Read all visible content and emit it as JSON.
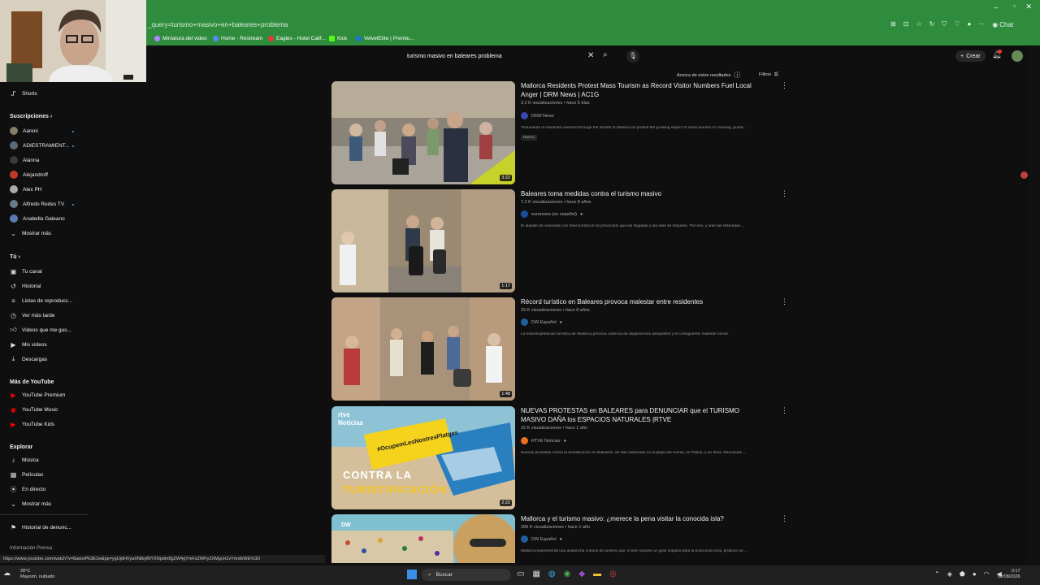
{
  "browser": {
    "address": "_query=turismo+masivo+en+baleares+problema",
    "chat_label": "Chat",
    "bookmarks": [
      {
        "label": "Miniatura del video",
        "color": "#b388ff"
      },
      {
        "label": "Home - Restream",
        "color": "#4f8cff"
      },
      {
        "label": "Eagles - Hotel Calif...",
        "color": "#e53935"
      },
      {
        "label": "Kick",
        "color": "#53fc18"
      },
      {
        "label": "VelvetElite | Premiu...",
        "color": "#1976d2"
      }
    ]
  },
  "youtube": {
    "search_query": "turismo masivo en baleares problema",
    "create_label": "Crear",
    "about_results": "Acerca de estos resultados",
    "filters_label": "Filtros"
  },
  "sidebar": {
    "shorts": "Shorts",
    "subscriptions_header": "Suscripciones",
    "subscriptions": [
      {
        "label": "Aareni",
        "color": "#8a7a6a",
        "new": true
      },
      {
        "label": "ADIESTRAMIENT...",
        "color": "#5a6a7a",
        "new": true
      },
      {
        "label": "Alanna",
        "color": "#3a3a3a",
        "new": false
      },
      {
        "label": "Alejandroff",
        "color": "#c0392b",
        "new": false
      },
      {
        "label": "Alex PH",
        "color": "#aaaaaa",
        "new": false
      },
      {
        "label": "Alfredo Redes TV",
        "color": "#6a7a8a",
        "new": true
      },
      {
        "label": "Anabella Galeano",
        "color": "#5d7bb0",
        "new": false
      }
    ],
    "show_more": "Mostrar más",
    "you_header": "Tú",
    "you_items": [
      {
        "label": "Tu canal",
        "icon": "channel-icon"
      },
      {
        "label": "Historial",
        "icon": "history-icon"
      },
      {
        "label": "Listas de reproducc...",
        "icon": "playlists-icon"
      },
      {
        "label": "Ver más tarde",
        "icon": "watch-later-icon"
      },
      {
        "label": "Videos que me gus...",
        "icon": "like-icon"
      },
      {
        "label": "Mis videos",
        "icon": "my-videos-icon"
      },
      {
        "label": "Descargas",
        "icon": "downloads-icon"
      }
    ],
    "more_header": "Más de YouTube",
    "more_items": [
      "YouTube Premium",
      "YouTube Music",
      "YouTube Kids"
    ],
    "explore_header": "Explorar",
    "explore_items": [
      {
        "label": "Música",
        "icon": "music-icon"
      },
      {
        "label": "Películas",
        "icon": "movies-icon"
      },
      {
        "label": "En directo",
        "icon": "live-icon"
      }
    ],
    "show_more_2": "Mostrar más",
    "report_history": "Historial de denunc...",
    "footer": "Información Prensa"
  },
  "results": [
    {
      "title": "Mallorca Residents Protest Mass Tourism as Record Visitor Numbers Fuel Local Anger | DRM News | AC1G",
      "meta": "3,2 K visualizaciones • hace 5 días",
      "channel": "DRM News",
      "channel_color": "#3949ab",
      "desc": "Thousands of residents marched through the streets of Mallorca to protest the growing impact of mass tourism on housing, public ...",
      "badge": "Nuevo",
      "duration": "3:22"
    },
    {
      "title": "Baleares toma medidas contra el turismo masivo",
      "meta": "7,2 K visualizaciones • hace 8 años",
      "channel": "euronews (en español)",
      "channel_color": "#1a4f9c",
      "desc": "El alquiler de viviendas con fines turísticos ha provocado que las llegadas a las islas se disparen. Por eso, y ante las reiteradas ...",
      "duration": "1:17"
    },
    {
      "title": "Récord turístico en Baleares provoca malestar entre residentes",
      "meta": "29 K visualizaciones • hace 8 años",
      "channel": "DW Español",
      "channel_color": "#1f5f9e",
      "desc": "La sobreexplotación turística de Mallorca provoca carencia de alojamientos asequibles y el consiguiente malestar social.",
      "duration": "1:48"
    },
    {
      "title": "NUEVAS PROTESTAS en BALEARES para DENUNCIAR que el TURISMO MASIVO DAÑA los ESPACIOS NATURALES |RTVE",
      "meta": "32 K visualizaciones • hace 1 año",
      "channel": "RTVE Noticias",
      "channel_color": "#e8711c",
      "desc": "Nuevas protestas contra la turistificación en Baleares. Se han celebrado en la playa del Arenal, en Palma, y en Ibiza. Denuncian ...",
      "duration": "2:22",
      "overlay_top": "rtve Noticias",
      "overlay_sign": "#OcupemLesNostresPlatges",
      "overlay_line1": "CONTRA LA",
      "overlay_line2": "TURISTIFICACIÓN"
    },
    {
      "title": "Mallorca y el turismo masivo: ¿merece la pena visitar la conocida isla?",
      "meta": "289 K visualizaciones • hace 1 año",
      "channel": "DW Español",
      "channel_color": "#1f5f9e",
      "desc": "Mallorca experimenta una avalancha crónica de turismo que, si bien supone un gran impulso para la economía local, produce un ...",
      "duration": ""
    }
  ],
  "status_url": "https://www.youtube.com/watch?v=8awsrPk3E1w&pp=ygUjdHVyaXNtbyBtYXNpdm8gZW4gYmFsZWFyZXMgcHJvYmxlbWE%3D",
  "taskbar": {
    "temp": "28°C",
    "weather": "Mayorm. nublado",
    "search": "Buscar",
    "time": "0:17",
    "date": "02/08/2026"
  }
}
